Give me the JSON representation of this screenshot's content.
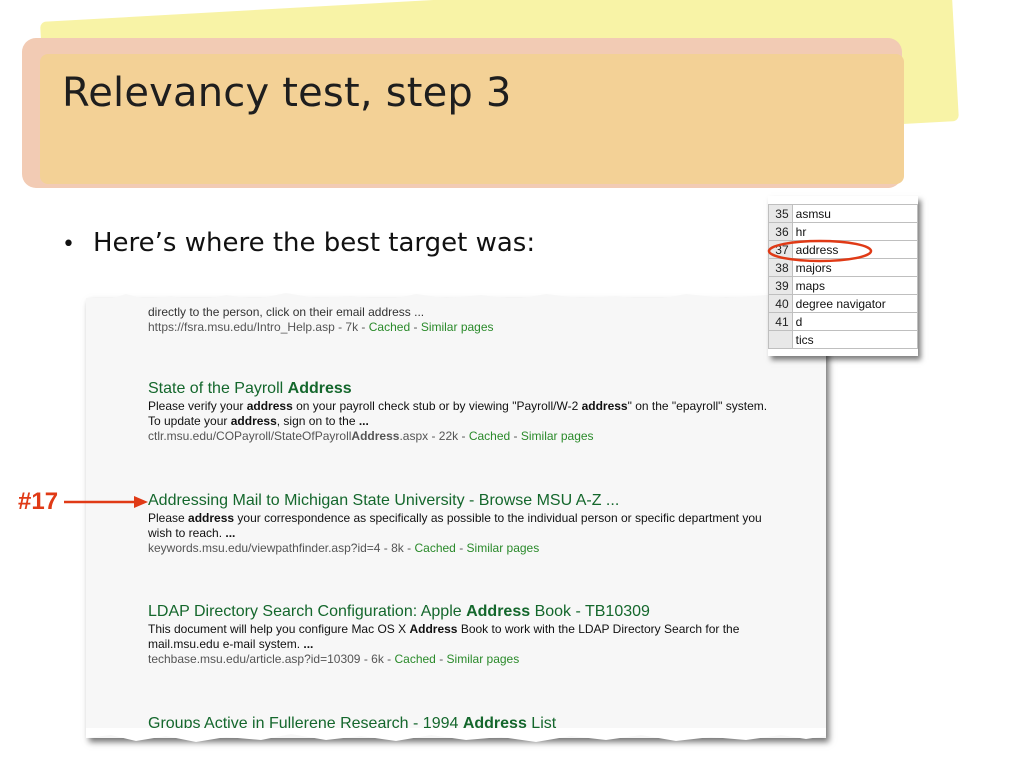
{
  "title": "Relevancy test, step 3",
  "bullet": "Here’s where the best target was:",
  "marker_label": "#17",
  "results": {
    "top_fragment": {
      "snippet": "directly to the person, click on their email address ...",
      "url": "https://fsra.msu.edu/Intro_Help.asp - 7k - ",
      "cached": "Cached",
      "sep": " - ",
      "similar": "Similar pages"
    },
    "r1": {
      "title_a": "State of the Payroll ",
      "title_b": "Address",
      "snippet_a": "Please verify your ",
      "snippet_b": "address",
      "snippet_c": " on your payroll check stub or by viewing \"Payroll/W-2 ",
      "snippet_d": "address",
      "snippet_e": "\" on the \"epayroll\" system. To update your ",
      "snippet_f": "address",
      "snippet_g": ", sign on to the ",
      "snippet_h": "...",
      "url_a": "ctlr.msu.edu/COPayroll/StateOfPayroll",
      "url_b": "Address",
      "url_c": ".aspx - 22k - ",
      "cached": "Cached",
      "sep": " - ",
      "similar": "Similar pages"
    },
    "r2": {
      "title": "Addressing Mail to Michigan State University - Browse MSU A-Z ...",
      "snippet_a": "Please ",
      "snippet_b": "address",
      "snippet_c": " your correspondence as specifically as possible to the individual person or specific department you wish to reach. ",
      "snippet_d": "...",
      "url": "keywords.msu.edu/viewpathfinder.asp?id=4 - 8k - ",
      "cached": "Cached",
      "sep": " - ",
      "similar": "Similar pages"
    },
    "r3": {
      "title_a": "LDAP Directory Search Configuration: Apple ",
      "title_b": "Address",
      "title_c": " Book - TB10309",
      "snippet_a": "This document will help you configure Mac OS X ",
      "snippet_b": "Address",
      "snippet_c": " Book to work with the LDAP Directory Search for the mail.msu.edu e-mail system. ",
      "snippet_d": "...",
      "url": "techbase.msu.edu/article.asp?id=10309 - 6k - ",
      "cached": "Cached",
      "sep": " - ",
      "similar": "Similar pages"
    },
    "r4": {
      "title_a": "Groups Active in Fullerene Research - 1994 ",
      "title_b": "Address",
      "title_c": " List"
    }
  },
  "sheet": {
    "rows": [
      {
        "num": "35",
        "val": "asmsu"
      },
      {
        "num": "36",
        "val": "hr"
      },
      {
        "num": "37",
        "val": "address"
      },
      {
        "num": "38",
        "val": "majors"
      },
      {
        "num": "39",
        "val": "maps"
      },
      {
        "num": "40",
        "val": "degree navigator"
      },
      {
        "num": "41",
        "val": "d"
      },
      {
        "num": "",
        "val": "tics"
      }
    ]
  },
  "colors": {
    "title_green": "#14672c",
    "link_green": "#2a8a2a",
    "accent_red": "#e03a16",
    "banner_orange": "#f3d196",
    "banner_pink": "#f2cbb4",
    "banner_yellow": "#f8f3a6"
  }
}
